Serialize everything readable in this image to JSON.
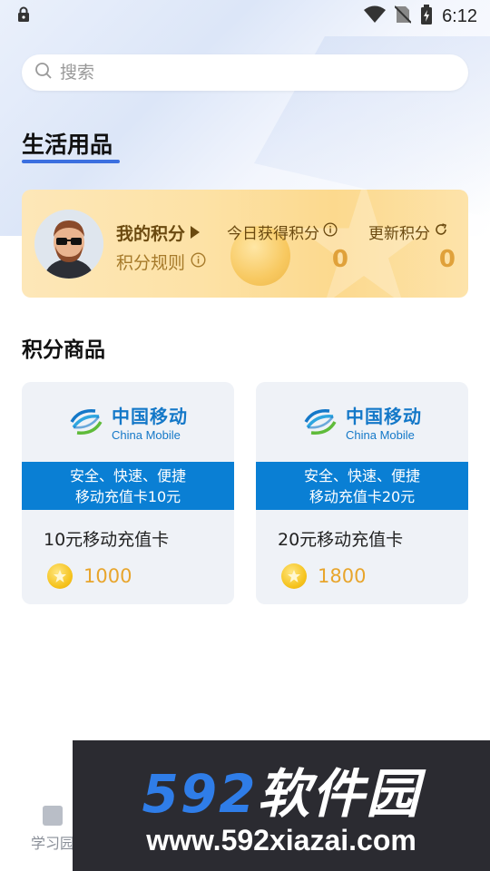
{
  "status_bar": {
    "time": "6:12"
  },
  "search": {
    "placeholder": "搜索"
  },
  "page": {
    "section_title": "生活用品"
  },
  "points_card": {
    "my_points_label": "我的积分",
    "rules_label": "积分规则",
    "today_label": "今日获得积分",
    "today_value": "0",
    "update_label": "更新积分",
    "update_value": "0"
  },
  "products": {
    "title": "积分商品",
    "items": [
      {
        "logo_cn": "中国移动",
        "logo_en": "China Mobile",
        "banner_line1": "安全、快速、便捷",
        "banner_line2": "移动充值卡10元",
        "name": "10元移动充值卡",
        "price": "1000"
      },
      {
        "logo_cn": "中国移动",
        "logo_en": "China Mobile",
        "banner_line1": "安全、快速、便捷",
        "banner_line2": "移动充值卡20元",
        "name": "20元移动充值卡",
        "price": "1800"
      }
    ]
  },
  "bottom_nav": {
    "tab_label": "学习园"
  },
  "watermark": {
    "brand_num": "592",
    "brand_cn": "软件园",
    "url": "www.592xiazai.com"
  },
  "colors": {
    "accent": "#3b6fe0",
    "points_gold": "#e0a13a",
    "mobile_blue": "#0a7fd4"
  },
  "icons": [
    "lock-icon",
    "wifi-icon",
    "no-sim-icon",
    "battery-icon",
    "search-icon",
    "play-arrow-icon",
    "info-icon",
    "refresh-icon",
    "coin-icon",
    "book-icon"
  ]
}
